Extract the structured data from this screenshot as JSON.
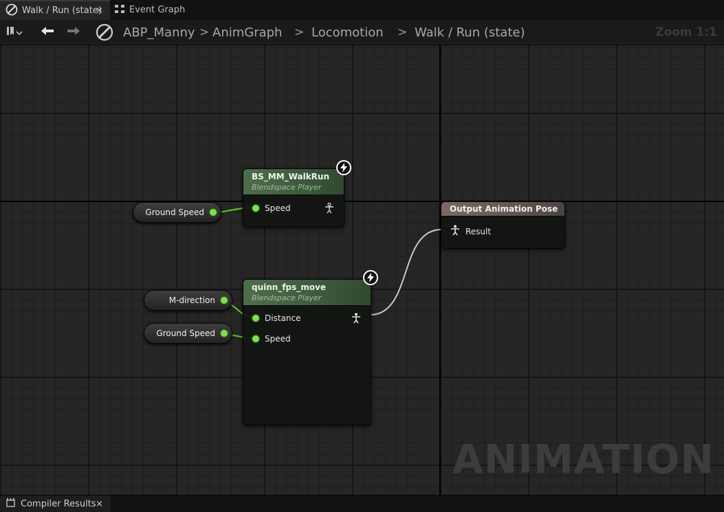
{
  "tabs": {
    "active": {
      "label": "Walk / Run (state)",
      "close": "×"
    },
    "second": {
      "label": "Event Graph"
    }
  },
  "toolbar": {
    "breadcrumbs": [
      "ABP_Manny",
      "AnimGraph",
      "Locomotion",
      "Walk / Run (state)"
    ],
    "separator": ">",
    "zoom": "Zoom 1:1"
  },
  "nodes": {
    "walkrun": {
      "title": "BS_MM_WalkRun",
      "subtitle": "Blendspace Player",
      "pin": "Speed"
    },
    "quinn": {
      "title": "quinn_fps_move",
      "subtitle": "Blendspace Player",
      "pins": [
        "Distance",
        "Speed"
      ]
    },
    "output": {
      "title": "Output Animation Pose",
      "pin": "Result"
    }
  },
  "variables": {
    "ground_speed_1": "Ground Speed",
    "m_direction": "M-direction",
    "ground_speed_2": "Ground Speed"
  },
  "watermark": "ANIMATION",
  "bottom": {
    "tab_label": "Compiler Results",
    "close": "×"
  },
  "colors": {
    "pin": "#7ee14a",
    "wire_float": "#5fd01e",
    "wire_pose": "#c8c8c8",
    "node_header": "#4d6e4a",
    "output_header": "#7a6a62"
  }
}
